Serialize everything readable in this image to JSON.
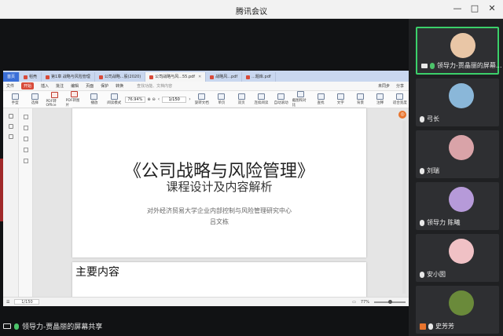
{
  "window": {
    "title": "腾讯会议",
    "controls": [
      "—",
      "□",
      "✕"
    ]
  },
  "wps": {
    "tabs": [
      {
        "label": "首页",
        "kind": "home"
      },
      {
        "label": "稻壳",
        "kind": "normal"
      },
      {
        "label": "第1章 战略与风险管理",
        "kind": "normal"
      },
      {
        "label": "公司战略...股(2020)",
        "kind": "normal"
      },
      {
        "label": "公司战略与风...55.pdf",
        "kind": "active"
      },
      {
        "label": "战略风...pdf",
        "kind": "normal"
      },
      {
        "label": "...题库.pdf",
        "kind": "normal"
      }
    ],
    "menus": [
      "文件",
      "开始",
      "插入",
      "批注",
      "编辑",
      "页面",
      "保护",
      "转换"
    ],
    "menu_right": [
      "未同步",
      "分享"
    ],
    "search_placeholder": "查找功能、文档内容",
    "toolbar": [
      {
        "label": "手型"
      },
      {
        "label": "选择"
      },
      {
        "label": "PDF转Office",
        "red": true
      },
      {
        "label": "PDF转图片",
        "red": true
      },
      {
        "label": "播放"
      },
      {
        "label": "阅读模式"
      }
    ],
    "zoom": "76.94%",
    "page": "1/150",
    "toolbar_right": [
      "旋转文档",
      "单页",
      "双页",
      "连续阅读",
      "自动滚动",
      "截图和对比",
      "查找",
      "文字",
      "背景",
      "注释",
      "适合宽度"
    ],
    "doc": {
      "title": "《公司战略与风险管理》",
      "subtitle": "课程设计及内容解析",
      "org": "对外经济贸易大学企业内部控制与风险管理研究中心",
      "author": "吕文栋",
      "next_heading": "主要内容"
    },
    "status": {
      "page": "1/150",
      "zoom": "77%"
    }
  },
  "share_caption": "领导力-贾晶丽的屏幕共享",
  "participants": [
    {
      "name": "领导力-贾晶丽的屏幕...",
      "mic": "green",
      "active": true,
      "avatar": "#e9c6a6"
    },
    {
      "name": "弓长",
      "mic": "white",
      "active": false,
      "avatar": "#8ab7d9"
    },
    {
      "name": "刘瑞",
      "mic": "white",
      "active": false,
      "avatar": "#d9a3a8"
    },
    {
      "name": "领导力 陈曦",
      "mic": "white",
      "active": false,
      "avatar": "#b69ad9"
    },
    {
      "name": "安小囡",
      "mic": "white",
      "active": false,
      "avatar": "#f0c1c5"
    },
    {
      "name": "史芳芳",
      "mic": "orange",
      "active": false,
      "avatar": "#6a8a3a"
    }
  ]
}
